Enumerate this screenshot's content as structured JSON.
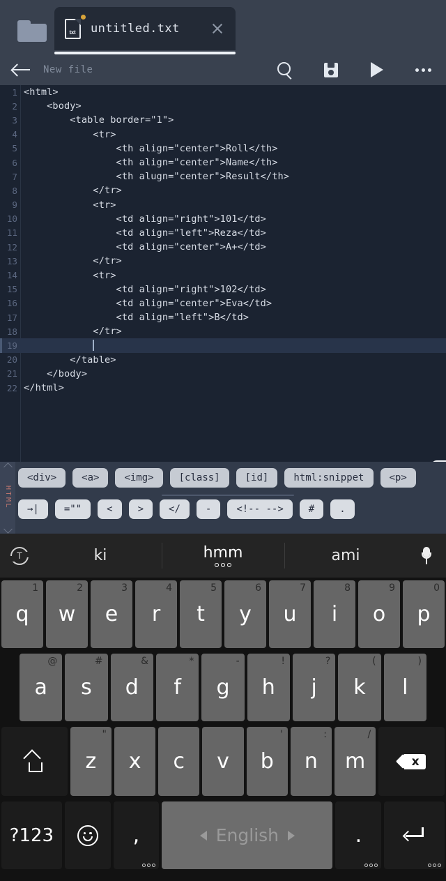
{
  "app": {
    "folder_icon": "folder-icon",
    "tab": {
      "file_icon_label": "txt",
      "title": "untitled.txt",
      "dirty": true,
      "close_icon": "close-icon"
    },
    "toolbar": {
      "back_icon": "arrow-left-icon",
      "subtitle": "New file",
      "search_icon": "search-icon",
      "save_icon": "save-icon",
      "run_icon": "play-icon",
      "more_icon": "more-icon"
    }
  },
  "editor": {
    "active_line": 19,
    "lines": [
      {
        "n": "1",
        "text": "<html>"
      },
      {
        "n": "2",
        "text": "    <body>"
      },
      {
        "n": "3",
        "text": "        <table border=\"1\">"
      },
      {
        "n": "4",
        "text": "            <tr>"
      },
      {
        "n": "5",
        "text": "                <th align=\"center\">Roll</th>"
      },
      {
        "n": "6",
        "text": "                <th align=\"center\">Name</th>"
      },
      {
        "n": "7",
        "text": "                <th alugn=\"center\">Result</th>"
      },
      {
        "n": "8",
        "text": "            </tr>"
      },
      {
        "n": "9",
        "text": "            <tr>"
      },
      {
        "n": "10",
        "text": "                <td align=\"right\">101</td>"
      },
      {
        "n": "11",
        "text": "                <td align=\"left\">Reza</td>"
      },
      {
        "n": "12",
        "text": "                <td align=\"center\">A+</td>"
      },
      {
        "n": "13",
        "text": "            </tr>"
      },
      {
        "n": "14",
        "text": "            <tr>"
      },
      {
        "n": "15",
        "text": "                <td align=\"right\">102</td>"
      },
      {
        "n": "16",
        "text": "                <td align=\"center\">Eva</td>"
      },
      {
        "n": "17",
        "text": "                <td align=\"left\">B</td>"
      },
      {
        "n": "18",
        "text": "            </tr>"
      },
      {
        "n": "19",
        "text": "            "
      },
      {
        "n": "20",
        "text": "        </table>"
      },
      {
        "n": "21",
        "text": "    </body>"
      },
      {
        "n": "22",
        "text": "</html>"
      }
    ],
    "panel_handle_icon": "chevron-left-icon"
  },
  "snippet_bar": {
    "language": "HTML",
    "up_icon": "chevron-up-icon",
    "down_icon": "chevron-down-icon",
    "row1": [
      "<div>",
      "<a>",
      "<img>",
      "[class]",
      "[id]",
      "html:snippet",
      "<p>"
    ],
    "row2": [
      "→|",
      "=\"\"",
      "<",
      ">",
      "</",
      "-",
      "<!-- -->",
      "#",
      "."
    ]
  },
  "keyboard": {
    "suggestions": {
      "left_icon": "translate-icon",
      "items": [
        {
          "text": "ki",
          "dots": false
        },
        {
          "text": "hmm",
          "dots": true
        },
        {
          "text": "ami",
          "dots": false
        }
      ],
      "right_icon": "microphone-icon"
    },
    "row1": [
      {
        "label": "q",
        "hint": "1"
      },
      {
        "label": "w",
        "hint": "2"
      },
      {
        "label": "e",
        "hint": "3"
      },
      {
        "label": "r",
        "hint": "4"
      },
      {
        "label": "t",
        "hint": "5"
      },
      {
        "label": "y",
        "hint": "6"
      },
      {
        "label": "u",
        "hint": "7"
      },
      {
        "label": "i",
        "hint": "8"
      },
      {
        "label": "o",
        "hint": "9"
      },
      {
        "label": "p",
        "hint": "0"
      }
    ],
    "row2": [
      {
        "label": "a",
        "hint": "@"
      },
      {
        "label": "s",
        "hint": "#"
      },
      {
        "label": "d",
        "hint": "&"
      },
      {
        "label": "f",
        "hint": "*"
      },
      {
        "label": "g",
        "hint": "-"
      },
      {
        "label": "h",
        "hint": "!"
      },
      {
        "label": "j",
        "hint": "?"
      },
      {
        "label": "k",
        "hint": "("
      },
      {
        "label": "l",
        "hint": ")"
      }
    ],
    "row3": [
      {
        "label": "z",
        "hint": "\""
      },
      {
        "label": "x",
        "hint": ""
      },
      {
        "label": "c",
        "hint": ""
      },
      {
        "label": "v",
        "hint": ""
      },
      {
        "label": "b",
        "hint": "'"
      },
      {
        "label": "n",
        "hint": ":"
      },
      {
        "label": "m",
        "hint": "/"
      }
    ],
    "shift_icon": "shift-icon",
    "backspace_icon": "backspace-icon",
    "symbols_key": "?123",
    "emoji_icon": "emoji-icon",
    "comma_key": ",",
    "space_label": "English",
    "period_key": ".",
    "enter_icon": "enter-icon"
  }
}
